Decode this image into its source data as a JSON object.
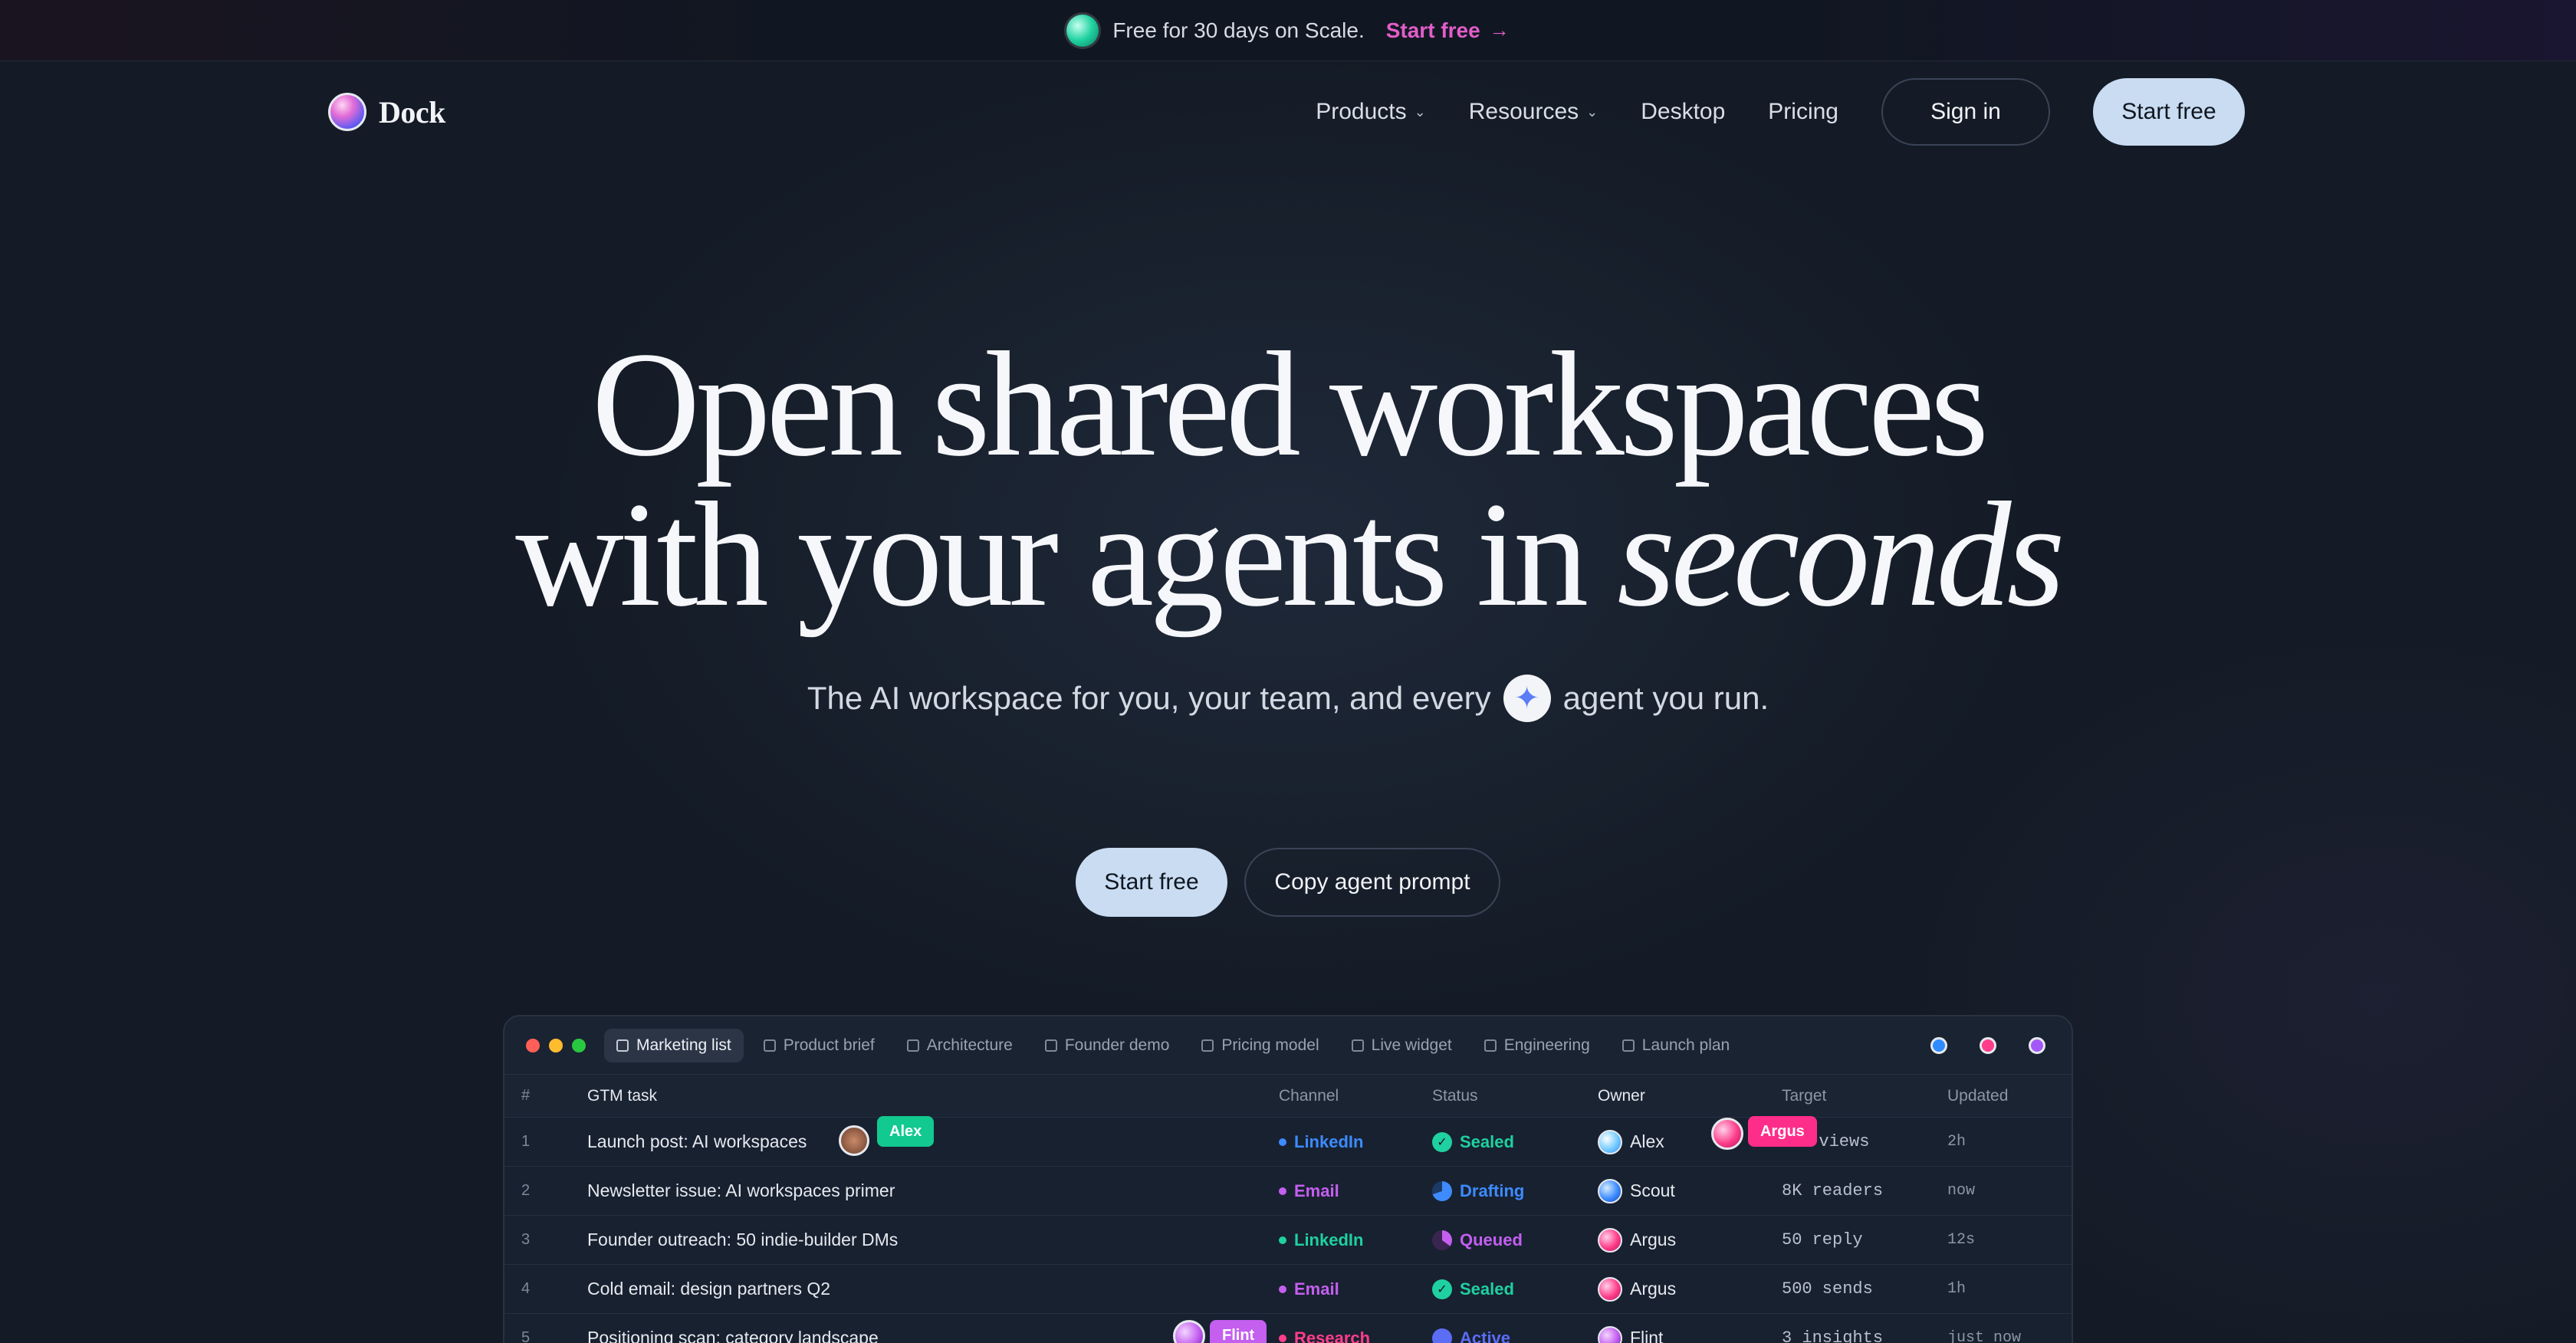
{
  "promo": {
    "text": "Free for 30 days on Scale.",
    "cta": "Start free",
    "arrow": "→"
  },
  "nav": {
    "logo_text": "Dock",
    "links": [
      {
        "label": "Products",
        "dropdown": true
      },
      {
        "label": "Resources",
        "dropdown": true
      },
      {
        "label": "Desktop"
      },
      {
        "label": "Pricing"
      }
    ],
    "sign_in": "Sign in",
    "start_free": "Start free"
  },
  "hero": {
    "title_line1": "Open shared workspaces",
    "title_line2_prefix": "with your agents in ",
    "title_line2_italic": "seconds",
    "subtitle_before": "The AI workspace for you, your team, and every",
    "subtitle_after": "agent you run.",
    "cta_primary": "Start free",
    "cta_secondary": "Copy agent prompt"
  },
  "app": {
    "window_dots": [
      "#ff5f57",
      "#febc2e",
      "#28c840"
    ],
    "tabs": [
      "Marketing list",
      "Product brief",
      "Architecture",
      "Founder demo",
      "Pricing model",
      "Live widget",
      "Engineering",
      "Launch plan"
    ],
    "active_tab": "Marketing list",
    "presence_colors": [
      "#2f8bff",
      "#ff3d8a",
      "#a259f7"
    ],
    "columns": [
      "#",
      "GTM task",
      "Channel",
      "Status",
      "Owner",
      "Target",
      "Updated"
    ],
    "rows": [
      {
        "num": "1",
        "task": "Launch post: AI workspaces",
        "channel": "LinkedIn",
        "channel_color": "#3d8bff",
        "status": "Sealed",
        "status_color": "#1fd1a0",
        "owner": "Alex",
        "target": "K views",
        "updated": "2h"
      },
      {
        "num": "2",
        "task": "Newsletter issue: AI workspaces primer",
        "channel": "Email",
        "channel_color": "#c45ff0",
        "status": "Drafting",
        "status_color": "#3d8bff",
        "owner": "Scout",
        "target": "8K readers",
        "updated": "now"
      },
      {
        "num": "3",
        "task": "Founder outreach: 50 indie-builder DMs",
        "channel": "LinkedIn",
        "channel_color": "#1fd1a0",
        "status": "Queued",
        "status_color": "#c45ff0",
        "owner": "Argus",
        "target": "50 reply",
        "updated": "12s"
      },
      {
        "num": "4",
        "task": "Cold email: design partners Q2",
        "channel": "Email",
        "channel_color": "#c45ff0",
        "status": "Sealed",
        "status_color": "#1fd1a0",
        "owner": "Argus",
        "target": "500 sends",
        "updated": "1h"
      },
      {
        "num": "5",
        "task": "Positioning scan: category landscape",
        "channel": "Research",
        "channel_color": "#ff3d8a",
        "status": "Active",
        "status_color": "#5b6cf5",
        "owner": "Flint",
        "target": "3 insights",
        "updated": "just now"
      }
    ],
    "cursor_tags": [
      {
        "label": "Alex",
        "color": "#12c990"
      },
      {
        "label": "Argus",
        "color": "#ff2d8a"
      },
      {
        "label": "Flint",
        "color": "#c45ff0"
      }
    ]
  }
}
